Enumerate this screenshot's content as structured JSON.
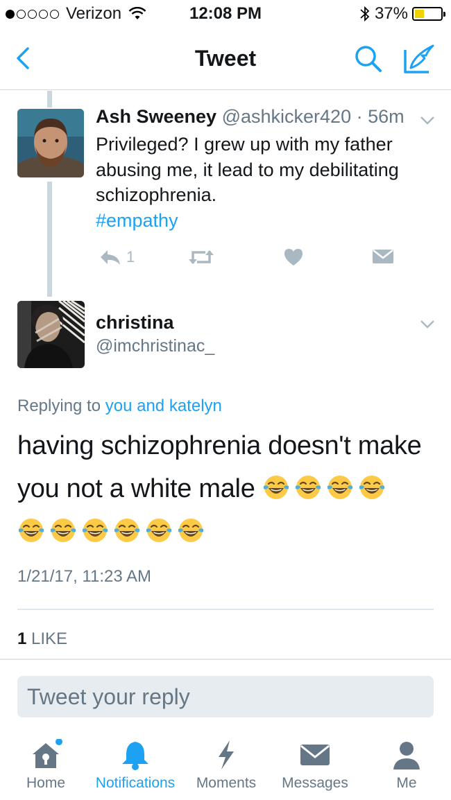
{
  "status_bar": {
    "carrier": "Verizon",
    "time": "12:08 PM",
    "battery": "37%",
    "battery_level": 0.37,
    "signal_bars_filled": 1,
    "signal_bars_total": 5
  },
  "nav": {
    "title": "Tweet"
  },
  "parent_tweet": {
    "name": "Ash Sweeney",
    "handle": "@ashkicker420",
    "separator": "·",
    "time_ago": "56m",
    "text": "Privileged? I grew up with my father abusing me, it lead to my debilitating schizophrenia.",
    "hashtag": "#empathy",
    "reply_count": "1"
  },
  "main_tweet": {
    "name": "christina",
    "handle": "@imchristinac_",
    "replying_prefix": "Replying to",
    "replying_to": "you and katelyn",
    "text": "having schizophrenia doesn't make you not a white male",
    "emoji_line1_count": 4,
    "emoji_line2_count": 6,
    "emoji": "face-with-tears-of-joy-emoji",
    "timestamp": "1/21/17, 11:23 AM",
    "like_count": "1",
    "like_label": "LIKE"
  },
  "reply_box": {
    "placeholder": "Tweet your reply"
  },
  "tabbar": {
    "tabs": [
      {
        "label": "Home",
        "icon": "home-icon",
        "active": false
      },
      {
        "label": "Notifications",
        "icon": "bell-icon",
        "active": true
      },
      {
        "label": "Moments",
        "icon": "lightning-icon",
        "active": false
      },
      {
        "label": "Messages",
        "icon": "envelope-icon",
        "active": false
      },
      {
        "label": "Me",
        "icon": "person-icon",
        "active": false
      }
    ]
  },
  "colors": {
    "accent": "#1da1f2",
    "muted": "#657786",
    "action_gray": "#aab8c2",
    "battery_fill": "#f5d000"
  }
}
